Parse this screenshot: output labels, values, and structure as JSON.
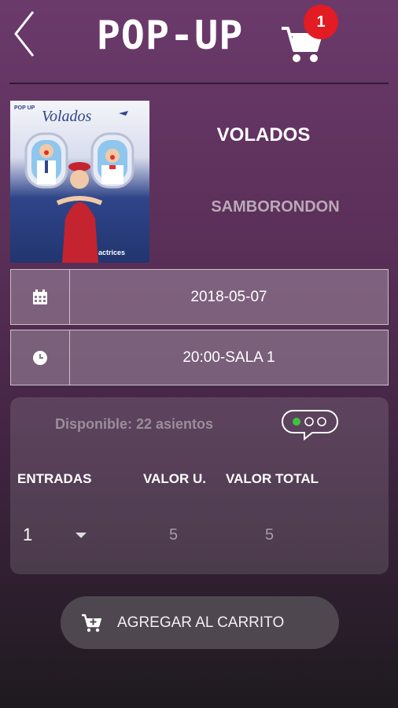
{
  "header": {
    "logo_text": "POP-UP",
    "cart_count": "1"
  },
  "event": {
    "poster": {
      "title": "Volados",
      "brand_top": "POP UP",
      "brand_bottom": "actrices"
    },
    "title": "VOLADOS",
    "location": "SAMBORONDON"
  },
  "date_row": {
    "icon": "calendar-icon",
    "value": "2018-05-07"
  },
  "time_row": {
    "icon": "clock-icon",
    "value": "20:00-SALA 1"
  },
  "tickets": {
    "availability": "Disponible: 22 asientos",
    "indicator_icon": "seat-availability-icon",
    "columns": [
      "ENTRADAS",
      "VALOR U.",
      "VALOR TOTAL"
    ],
    "quantity": "1",
    "unit_value": "5",
    "total_value": "5"
  },
  "add_to_cart": {
    "label": "AGREGAR AL CARRITO",
    "icon": "add-cart-icon"
  },
  "colors": {
    "badge": "#e31b23",
    "indicator_green": "#3ec33e"
  }
}
